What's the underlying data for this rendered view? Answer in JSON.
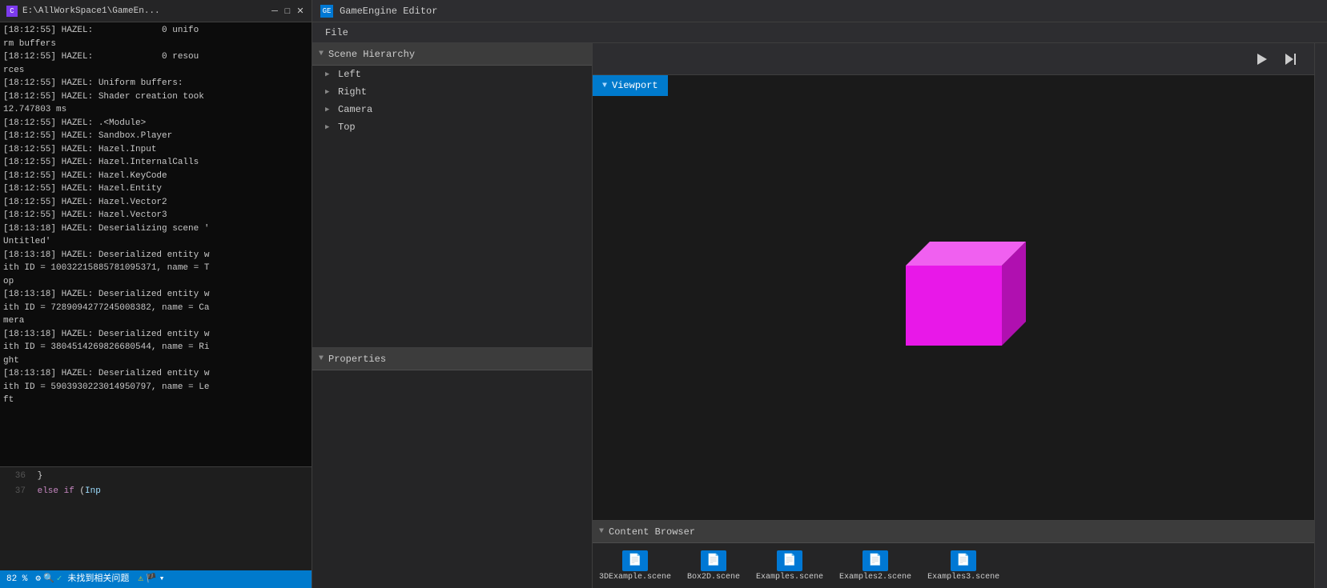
{
  "console_window": {
    "title": "E:\\AllWorkSpace1\\GameEn...",
    "icon_text": "C",
    "lines": [
      "[18:12:55] HAZEL:             0 unifo",
      "rm buffers",
      "[18:12:55] HAZEL:             0 resou",
      "rces",
      "[18:12:55] HAZEL: Uniform buffers:",
      "[18:12:55] HAZEL: Shader creation took",
      "12.747803 ms",
      "[18:12:55] HAZEL: .<Module>",
      "[18:12:55] HAZEL: Sandbox.Player",
      "[18:12:55] HAZEL: Hazel.Input",
      "[18:12:55] HAZEL: Hazel.InternalCalls",
      "[18:12:55] HAZEL: Hazel.KeyCode",
      "[18:12:55] HAZEL: Hazel.Entity",
      "[18:12:55] HAZEL: Hazel.Vector2",
      "[18:12:55] HAZEL: Hazel.Vector3",
      "[18:13:18] HAZEL: Deserializing scene '",
      "Untitled'",
      "[18:13:18] HAZEL: Deserialized entity w",
      "ith ID = 10032215885781095371, name = T",
      "op",
      "[18:13:18] HAZEL: Deserialized entity w",
      "ith ID = 7289094277245008382, name = Ca",
      "mera",
      "[18:13:18] HAZEL: Deserialized entity w",
      "ith ID = 3804514269826680544, name = Ri",
      "ght",
      "[18:13:18] HAZEL: Deserialized entity w",
      "ith ID = 5903930223014950797, name = Le",
      "ft"
    ]
  },
  "code_editor": {
    "lines": [
      {
        "num": 36,
        "code": "            }"
      },
      {
        "num": 37,
        "code": "            else if (Inp"
      }
    ],
    "zoom": "82 %"
  },
  "editor_window": {
    "title": "GameEngine Editor",
    "icon_text": "GE"
  },
  "menu": {
    "items": [
      "File"
    ]
  },
  "scene_hierarchy": {
    "title": "Scene Hierarchy",
    "items": [
      {
        "label": "Left",
        "has_arrow": true
      },
      {
        "label": "Right",
        "has_arrow": true
      },
      {
        "label": "Camera",
        "has_arrow": true
      },
      {
        "label": "Top",
        "has_arrow": true
      }
    ]
  },
  "properties": {
    "title": "Properties"
  },
  "viewport": {
    "tab_label": "Viewport",
    "play_icon": "▶",
    "step_icon": "⏭"
  },
  "content_browser": {
    "title": "Content Browser",
    "items": [
      {
        "label": "3DExample.scene",
        "icon": "📄"
      },
      {
        "label": "Box2D.scene",
        "icon": "📄"
      },
      {
        "label": "Examples.scene",
        "icon": "📄"
      },
      {
        "label": "Examples2.scene",
        "icon": "📄"
      },
      {
        "label": "Examples3.scene",
        "icon": "📄"
      }
    ]
  },
  "status_bar": {
    "zoom": "82 %",
    "status_text": "未找到相关问题",
    "icon1": "⚙",
    "icon2": "🔍",
    "icon3": "✓"
  },
  "colors": {
    "cube_front": "#e818e8",
    "cube_top": "#f060f0",
    "cube_right": "#b010b0",
    "accent": "#007acc"
  }
}
